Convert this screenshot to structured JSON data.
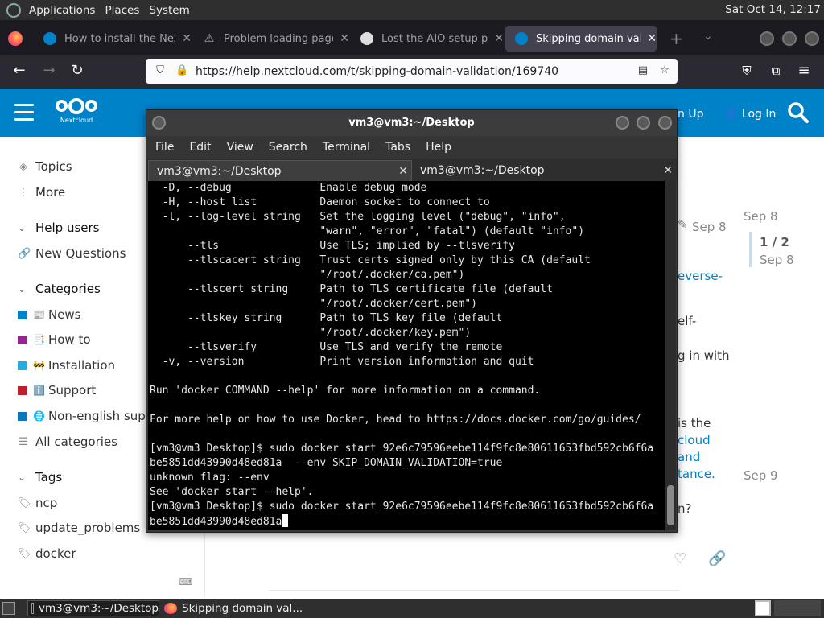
{
  "top_panel": {
    "menus": [
      "Applications",
      "Places",
      "System"
    ],
    "clock": "Sat Oct 14, 12:17"
  },
  "browser": {
    "tabs": [
      {
        "title": "How to install the Nextcloud",
        "icon": "nextcloud-icon",
        "active": false
      },
      {
        "title": "Problem loading page",
        "icon": "warning-icon",
        "active": false
      },
      {
        "title": "Lost the AIO setup page",
        "icon": "github-icon",
        "active": false
      },
      {
        "title": "Skipping domain validation",
        "icon": "nextcloud-icon",
        "active": true
      }
    ],
    "url": "https://help.nextcloud.com/t/skipping-domain-validation/169740"
  },
  "nc_header": {
    "logo_text": "Nextcloud",
    "signup_label": "n Up",
    "login_label": "Log In"
  },
  "sidebar": {
    "topics": "Topics",
    "more": "More",
    "help_users": "Help users",
    "new_questions": "New Questions",
    "categories_head": "Categories",
    "categories": [
      {
        "label": "News",
        "color": "#0082c9",
        "emoji": "📰"
      },
      {
        "label": "How to",
        "color": "#92278f",
        "emoji": "📑"
      },
      {
        "label": "Installation",
        "color": "#25aae1",
        "emoji": "🚧"
      },
      {
        "label": "Support",
        "color": "#bf1e2e",
        "emoji": "ℹ️"
      },
      {
        "label": "Non-english supp",
        "color": "#0e76bd",
        "emoji": "🌐"
      }
    ],
    "all_categories": "All categories",
    "tags_head": "Tags",
    "tags": [
      "ncp",
      "update_problems",
      "docker"
    ]
  },
  "page": {
    "date1": "Sep 8",
    "date2": "Sep 8",
    "progress": "1 / 2",
    "progress_date": "Sep 8",
    "frag_reverse": "everse-",
    "frag_elf": "elf-",
    "frag_gin": "g in with",
    "frag_isthe": "is the",
    "frag_cloud": "cloud",
    "frag_and": "and",
    "frag_tance": "tance.",
    "frag_n": "n?",
    "date3": "Sep 9"
  },
  "terminal": {
    "title": "vm3@vm3:~/Desktop",
    "menus": [
      "File",
      "Edit",
      "View",
      "Search",
      "Terminal",
      "Tabs",
      "Help"
    ],
    "tabs": [
      "vm3@vm3:~/Desktop",
      "vm3@vm3:~/Desktop"
    ],
    "lines": [
      "  -D, --debug              Enable debug mode",
      "  -H, --host list          Daemon socket to connect to",
      "  -l, --log-level string   Set the logging level (\"debug\", \"info\",",
      "                           \"warn\", \"error\", \"fatal\") (default \"info\")",
      "      --tls                Use TLS; implied by --tlsverify",
      "      --tlscacert string   Trust certs signed only by this CA (default",
      "                           \"/root/.docker/ca.pem\")",
      "      --tlscert string     Path to TLS certificate file (default",
      "                           \"/root/.docker/cert.pem\")",
      "      --tlskey string      Path to TLS key file (default",
      "                           \"/root/.docker/key.pem\")",
      "      --tlsverify          Use TLS and verify the remote",
      "  -v, --version            Print version information and quit",
      "",
      "Run 'docker COMMAND --help' for more information on a command.",
      "",
      "For more help on how to use Docker, head to https://docs.docker.com/go/guides/",
      "",
      "[vm3@vm3 Desktop]$ sudo docker start 92e6c79596eebe114f9fc8e80611653fbd592cb6f6a",
      "be5851dd43990d48ed81a  --env SKIP_DOMAIN_VALIDATION=true",
      "unknown flag: --env",
      "See 'docker start --help'.",
      "[vm3@vm3 Desktop]$ sudo docker start 92e6c79596eebe114f9fc8e80611653fbd592cb6f6a",
      "be5851dd43990d48ed81a"
    ]
  },
  "taskbar": {
    "tasks": [
      "vm3@vm3:~/Desktop",
      "Skipping domain val..."
    ]
  }
}
